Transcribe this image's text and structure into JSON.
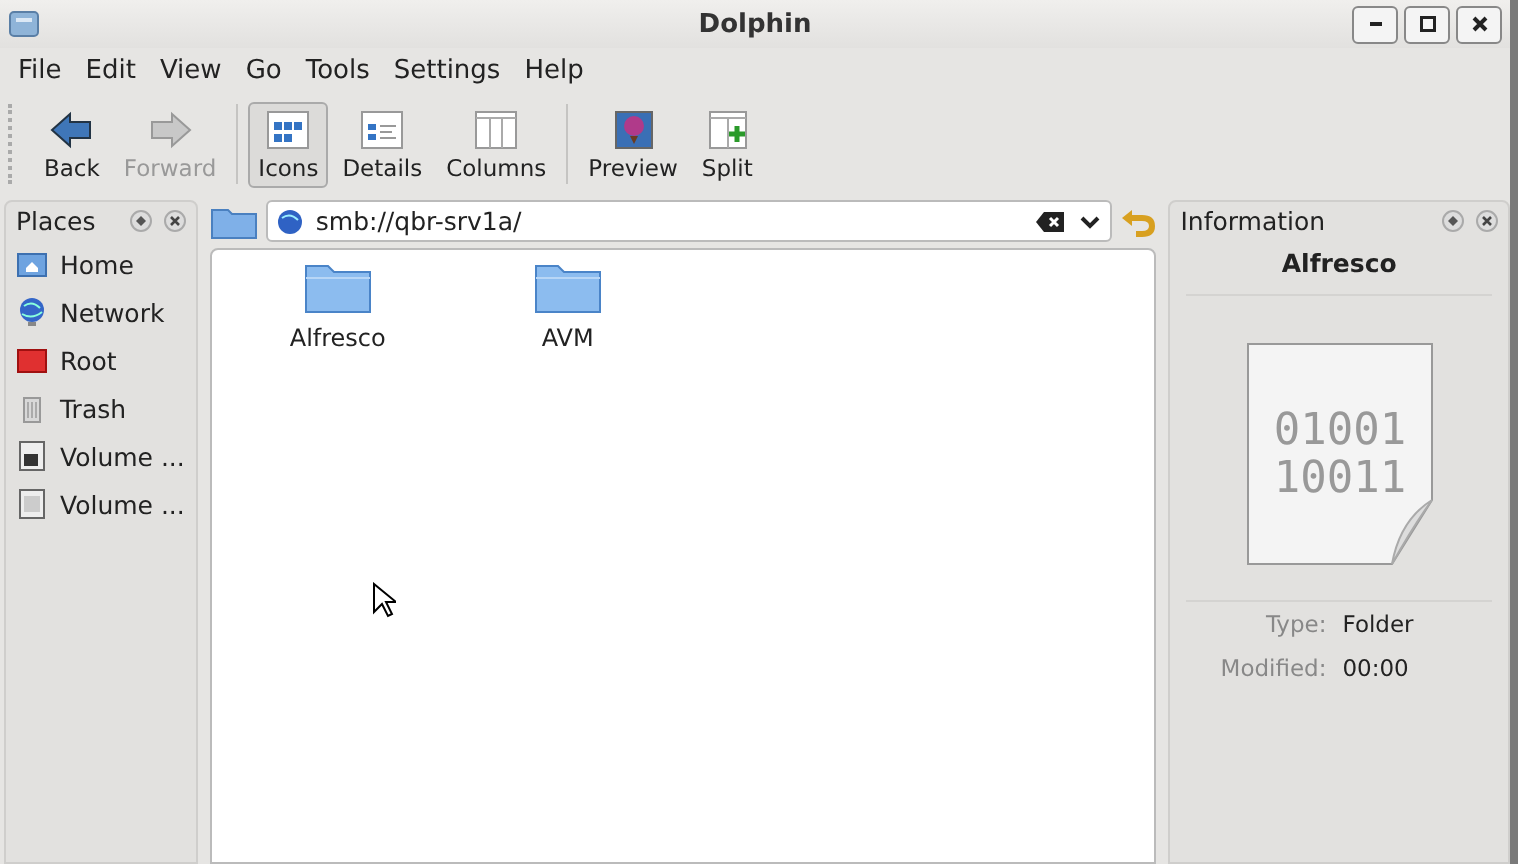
{
  "window": {
    "title": "Dolphin"
  },
  "menu": [
    "File",
    "Edit",
    "View",
    "Go",
    "Tools",
    "Settings",
    "Help"
  ],
  "toolbar": [
    {
      "label": "Back",
      "disabled": false,
      "selected": false
    },
    {
      "label": "Forward",
      "disabled": true,
      "selected": false
    },
    {
      "label": "Icons",
      "disabled": false,
      "selected": true
    },
    {
      "label": "Details",
      "disabled": false,
      "selected": false
    },
    {
      "label": "Columns",
      "disabled": false,
      "selected": false
    },
    {
      "label": "Preview",
      "disabled": false,
      "selected": false
    },
    {
      "label": "Split",
      "disabled": false,
      "selected": false
    }
  ],
  "places": {
    "title": "Places",
    "items": [
      {
        "label": "Home"
      },
      {
        "label": "Network"
      },
      {
        "label": "Root"
      },
      {
        "label": "Trash"
      },
      {
        "label": "Volume ..."
      },
      {
        "label": "Volume ..."
      }
    ]
  },
  "location": {
    "value": "smb://qbr-srv1a/"
  },
  "files": [
    {
      "name": "Alfresco"
    },
    {
      "name": "AVM"
    }
  ],
  "information": {
    "title": "Information",
    "name": "Alfresco",
    "icon_lines": [
      "01001",
      "10011"
    ],
    "fields": [
      {
        "label": "Type:",
        "value": "Folder"
      },
      {
        "label": "Modified:",
        "value": "00:00"
      }
    ]
  }
}
